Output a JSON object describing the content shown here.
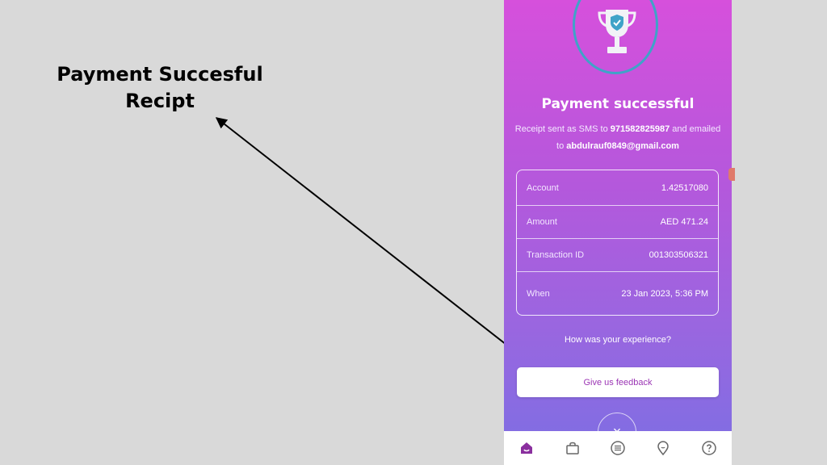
{
  "caption": {
    "line1": "Payment Succesful",
    "line2": "Recipt"
  },
  "receipt_screen": {
    "title": "Payment successful",
    "sub_prefix": "Receipt sent as SMS to ",
    "phone": "971582825987",
    "sub_middle": " and emailed to ",
    "email": "abdulrauf0849@gmail.com",
    "rows": [
      {
        "label": "Account",
        "value": "1.42517080"
      },
      {
        "label": "Amount",
        "value": "AED 471.24"
      },
      {
        "label": "Transaction ID",
        "value": "001303506321"
      },
      {
        "label": "When",
        "value": "23 Jan 2023, 5:36 PM"
      }
    ],
    "question": "How was your experience?",
    "feedback_label": "Give us feedback",
    "close_glyph": "×"
  },
  "colors": {
    "gradient_top": "#d650dc",
    "gradient_bottom": "#7c6fe3",
    "accent_text": "#9b35b4",
    "ring": "#3fa3c8",
    "nav_active": "#8a2f9e"
  },
  "nav_icons": [
    "home-icon",
    "bag-icon",
    "list-icon",
    "location-icon",
    "help-icon"
  ]
}
